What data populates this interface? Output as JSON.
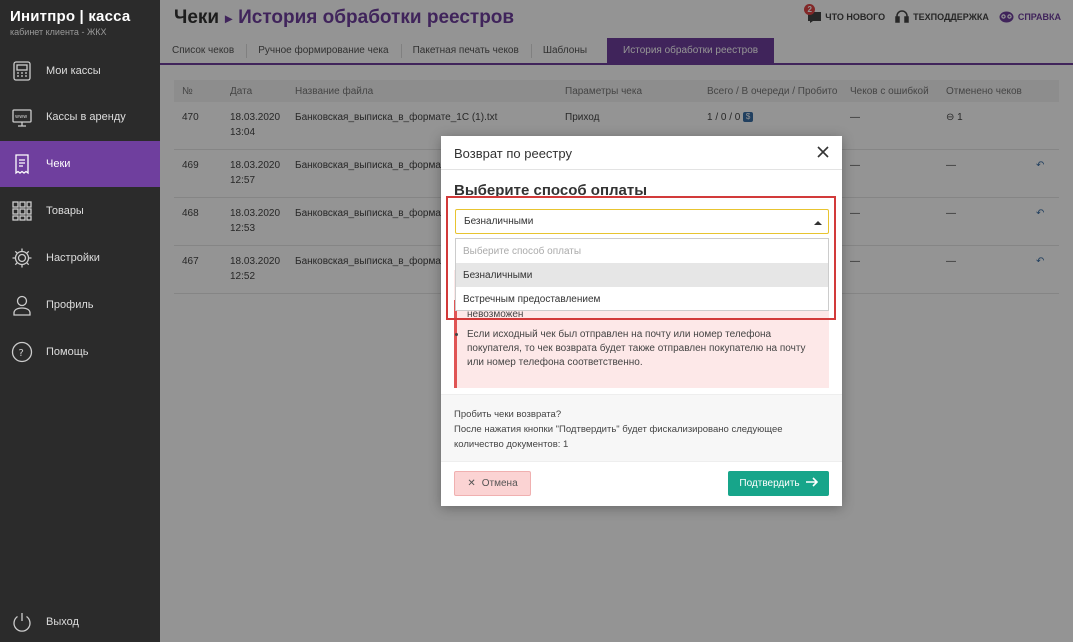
{
  "brand": {
    "name": "Инитпро | касса",
    "subtitle": "кабинет клиента - ЖКХ"
  },
  "sidebar": {
    "items": [
      {
        "label": "Мои кассы",
        "icon": "register-icon"
      },
      {
        "label": "Кассы в аренду",
        "icon": "www-icon"
      },
      {
        "label": "Чеки",
        "icon": "receipt-icon",
        "active": true
      },
      {
        "label": "Товары",
        "icon": "grid-icon"
      },
      {
        "label": "Настройки",
        "icon": "gear-icon"
      },
      {
        "label": "Профиль",
        "icon": "user-icon"
      },
      {
        "label": "Помощь",
        "icon": "question-icon"
      }
    ],
    "logout": "Выход"
  },
  "header": {
    "title": "Чеки",
    "subtitle": "История обработки реестров",
    "links": {
      "news": "ЧТО НОВОГО",
      "news_badge": "2",
      "support": "ТЕХПОДДЕРЖКА",
      "help": "СПРАВКА"
    }
  },
  "tabs": [
    {
      "label": "Список чеков"
    },
    {
      "label": "Ручное формирование чека"
    },
    {
      "label": "Пакетная печать чеков"
    },
    {
      "label": "Шаблоны"
    },
    {
      "label": "История обработки реестров",
      "active": true
    }
  ],
  "table": {
    "columns": [
      "№",
      "Дата",
      "Название файла",
      "Параметры чека",
      "Всего / В очереди / Пробито",
      "Чеков с ошибкой",
      "Отменено чеков"
    ],
    "rows": [
      {
        "no": "470",
        "date": "18.03.2020",
        "time": "13:04",
        "file": "Банковская_выписка_в_формате_1С (1).txt",
        "params": "Приход",
        "totals": "1 / 0 / 0",
        "errors": "—",
        "canceled": "1"
      },
      {
        "no": "469",
        "date": "18.03.2020",
        "time": "12:57",
        "file": "Банковская_выписка_в_формате",
        "params": "",
        "totals": "",
        "errors": "—",
        "canceled": "—"
      },
      {
        "no": "468",
        "date": "18.03.2020",
        "time": "12:53",
        "file": "Банковская_выписка_в_формате",
        "params": "",
        "totals": "",
        "errors": "—",
        "canceled": "—"
      },
      {
        "no": "467",
        "date": "18.03.2020",
        "time": "12:52",
        "file": "Банковская_выписка_в_формате",
        "params": "",
        "totals": "",
        "errors": "—",
        "canceled": "—"
      }
    ]
  },
  "modal": {
    "title": "Возврат по реестру",
    "pay_heading": "Выберите способ оплаты",
    "select_value": "Безналичными",
    "options": [
      {
        "label": "Выберите способ оплаты",
        "placeholder": true
      },
      {
        "label": "Безналичными",
        "selected": true
      },
      {
        "label": "Встречным предоставлением"
      }
    ],
    "warning_partial": "невозможен",
    "warning_text": "Если исходный чек был отправлен на почту или номер телефона покупателя, то чек возврата будет также отправлен покупателю на почту или номер телефона соответственно.",
    "info_line1": "Пробить чеки возврата?",
    "info_line2": "После нажатия кнопки \"Подтвердить\" будет фискализировано следующее количество документов: 1",
    "cancel_label": "Отмена",
    "confirm_label": "Подтвердить"
  },
  "colors": {
    "accent": "#6f3f9e",
    "sidebar": "#2b2b2b",
    "confirm": "#17a58a",
    "highlight": "#d23a3a"
  }
}
